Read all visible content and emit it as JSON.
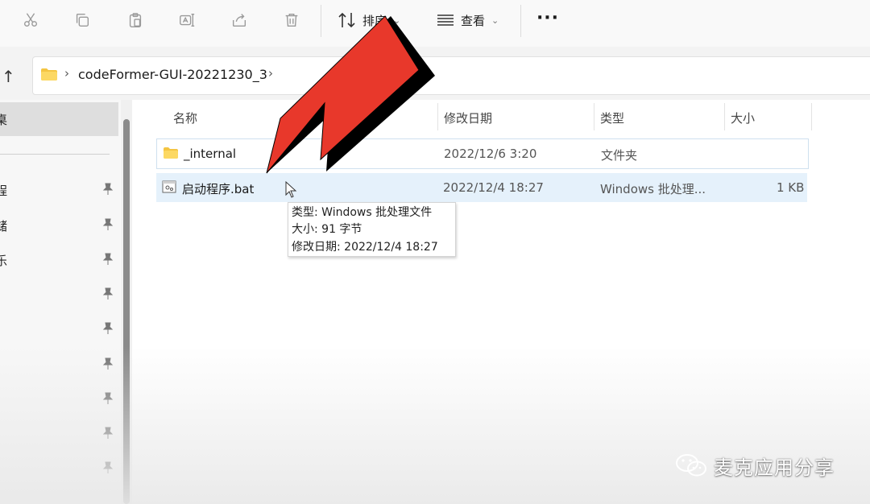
{
  "toolbar": {
    "sort_label": "排序",
    "view_label": "查看",
    "more_label": "···",
    "icons": [
      "cut-icon",
      "copy-icon",
      "paste-icon",
      "rename-icon",
      "share-icon",
      "delete-icon",
      "sort-icon",
      "view-icon",
      "more-icon"
    ]
  },
  "address": {
    "crumb": "codeFormer-GUI-20221230_3",
    "separator": "›",
    "up_icon": "↑"
  },
  "nav": {
    "selected_label": "桌",
    "items": [
      "程",
      "储",
      "乐"
    ]
  },
  "columns": {
    "name": "名称",
    "modified": "修改日期",
    "type": "类型",
    "size": "大小"
  },
  "files": [
    {
      "name": "_internal",
      "modified": "2022/12/6 3:20",
      "type": "文件夹",
      "size": ""
    },
    {
      "name": "启动程序.bat",
      "modified": "2022/12/4 18:27",
      "type": "Windows 批处理...",
      "size": "1 KB"
    }
  ],
  "tooltip": {
    "type_line": "类型: Windows 批处理文件",
    "size_line": "大小: 91 字节",
    "date_line": "修改日期: 2022/12/4 18:27"
  },
  "watermark": {
    "text": "麦克应用分享"
  },
  "colors": {
    "arrow_red": "#e8382b",
    "selection_blue": "#e5f1fb",
    "folder_yellow": "#f4c542"
  }
}
